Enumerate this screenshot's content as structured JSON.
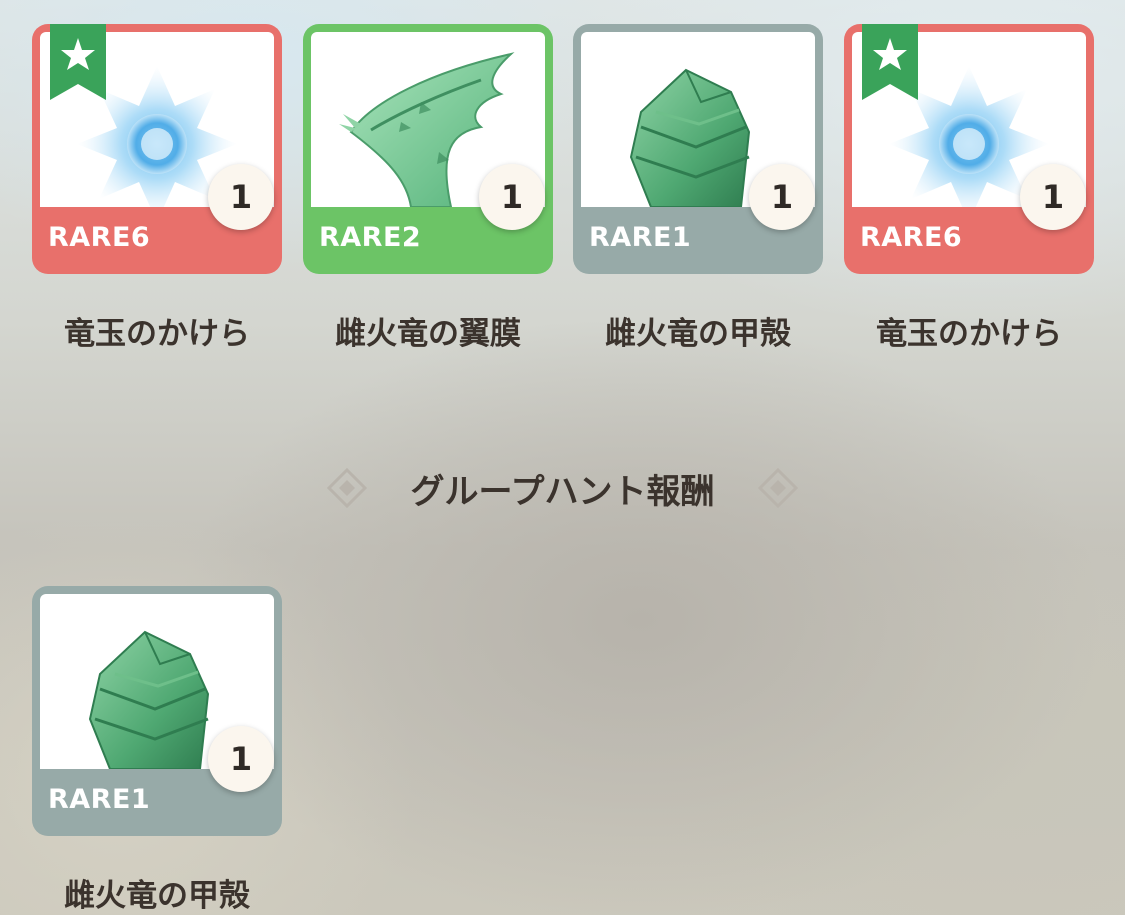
{
  "rewards": [
    {
      "rarity": "RARE6",
      "count": "1",
      "name": "竜玉のかけら",
      "featured": true
    },
    {
      "rarity": "RARE2",
      "count": "1",
      "name": "雌火竜の翼膜",
      "featured": false
    },
    {
      "rarity": "RARE1",
      "count": "1",
      "name": "雌火竜の甲殻",
      "featured": false
    },
    {
      "rarity": "RARE6",
      "count": "1",
      "name": "竜玉のかけら",
      "featured": true
    }
  ],
  "group_hunt": {
    "title": "グループハント報酬",
    "items": [
      {
        "rarity": "RARE1",
        "count": "1",
        "name": "雌火竜の甲殻"
      }
    ]
  },
  "colors": {
    "rare6": "#e8706b",
    "rare2": "#6cc466",
    "rare1": "#97aaa8",
    "featured_ribbon": "#3aa35a",
    "text_dark": "#3b332d"
  },
  "icons": {
    "dragon_orb_shard": "dragon-orb-shard-icon",
    "rathian_wing_membrane": "wing-membrane-icon",
    "rathian_shell": "shell-icon",
    "featured_star": "star-icon",
    "section_ornament": "diamond-ornament-icon"
  }
}
